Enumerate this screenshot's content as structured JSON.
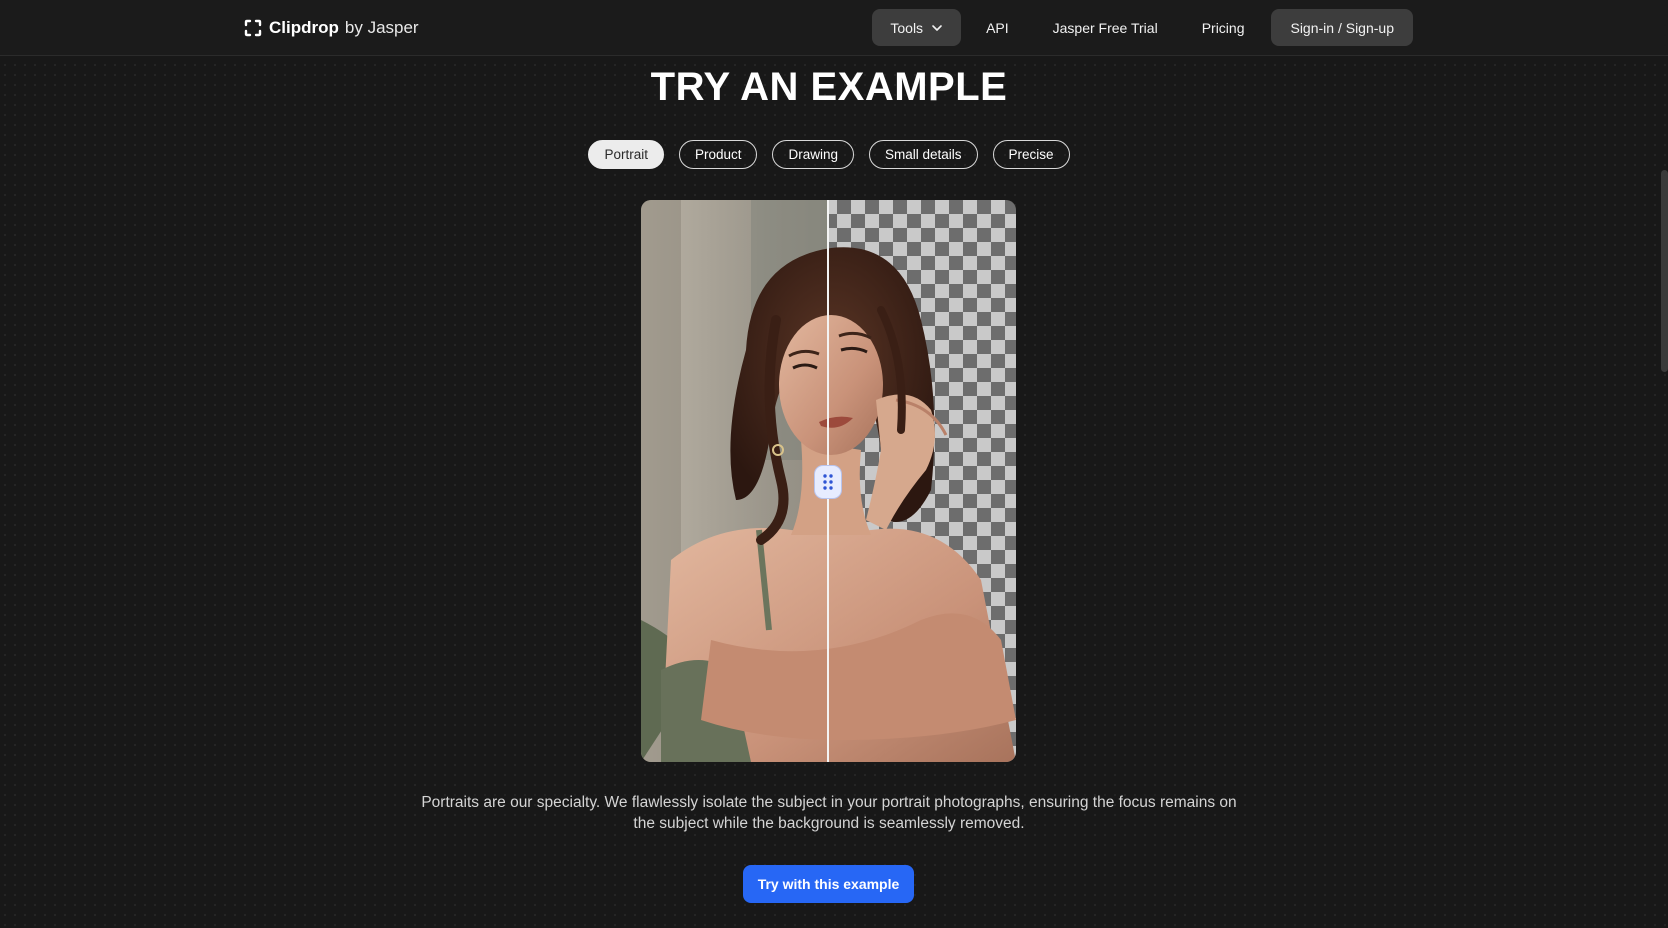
{
  "brand": {
    "name": "Clipdrop",
    "by": "by Jasper"
  },
  "nav": {
    "tools": "Tools",
    "api": "API",
    "free_trial": "Jasper Free Trial",
    "pricing": "Pricing",
    "signin": "Sign-in / Sign-up"
  },
  "heading": "TRY AN EXAMPLE",
  "tabs": [
    {
      "label": "Portrait",
      "active": true
    },
    {
      "label": "Product",
      "active": false
    },
    {
      "label": "Drawing",
      "active": false
    },
    {
      "label": "Small details",
      "active": false
    },
    {
      "label": "Precise",
      "active": false
    }
  ],
  "comparison": {
    "split_fraction": 0.5
  },
  "description": "Portraits are our specialty. We flawlessly isolate the subject in your portrait photographs, ensuring the focus remains on the subject while the background is seamlessly removed.",
  "cta": "Try with this example",
  "colors": {
    "background": "#181818",
    "accent": "#2767f5",
    "active_tab_bg": "#ececec"
  }
}
